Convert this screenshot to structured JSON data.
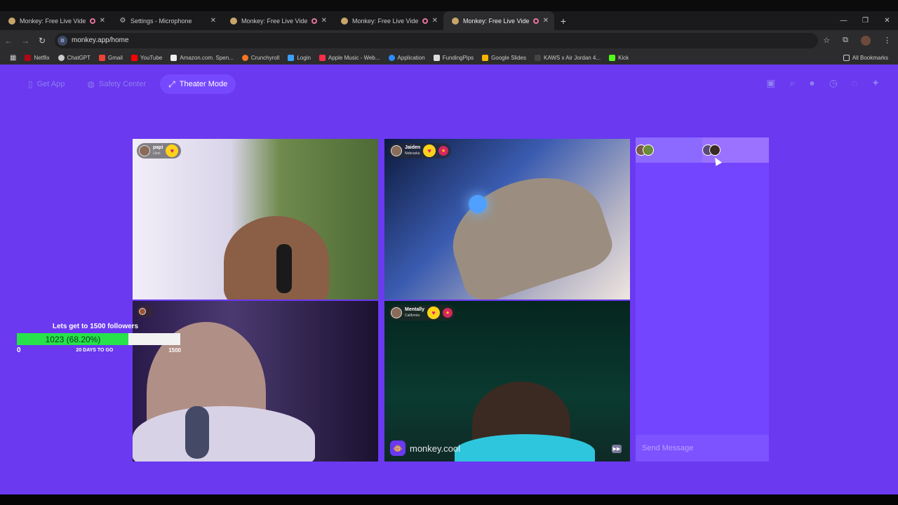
{
  "browser": {
    "tabs": [
      {
        "title": "Monkey: Free Live Video Ch",
        "active": false,
        "recording": true
      },
      {
        "title": "Settings - Microphone",
        "active": false,
        "recording": false
      },
      {
        "title": "Monkey: Free Live Video Ch",
        "active": false,
        "recording": true
      },
      {
        "title": "Monkey: Free Live Video Ch",
        "active": false,
        "recording": true
      },
      {
        "title": "Monkey: Free Live Video Ch",
        "active": true,
        "recording": true
      }
    ],
    "new_tab": "+",
    "close": "✕",
    "url": "monkey.app/home",
    "bookmarks": [
      {
        "label": "Netflix",
        "color": "#b20710"
      },
      {
        "label": "ChatGPT",
        "color": "#cccccc"
      },
      {
        "label": "Gmail",
        "color": "#ea4335"
      },
      {
        "label": "YouTube",
        "color": "#ff0000"
      },
      {
        "label": "Amazon.com. Spen...",
        "color": "#eeeeee"
      },
      {
        "label": "Crunchyroll",
        "color": "#f47521"
      },
      {
        "label": "Login",
        "color": "#3aa0ff"
      },
      {
        "label": "Apple Music - Web...",
        "color": "#fa2d48"
      },
      {
        "label": "Application",
        "color": "#2b8cff"
      },
      {
        "label": "FundingPips",
        "color": "#dddddd"
      },
      {
        "label": "Google Slides",
        "color": "#f4b400"
      },
      {
        "label": "KAWS x Air Jordan 4...",
        "color": "#222222"
      },
      {
        "label": "Kick",
        "color": "#53fc18"
      }
    ],
    "all_bookmarks": "All Bookmarks"
  },
  "app": {
    "buttons": {
      "get_app": "Get App",
      "safety_center": "Safety Center",
      "theater_mode": "Theater Mode"
    },
    "accent": "#6a39f0",
    "tiles": [
      {
        "name": "papi",
        "location": "Utah"
      },
      {
        "name": "Jaiden",
        "location": "Nebraska"
      },
      {
        "name": "",
        "location": ""
      },
      {
        "name": "Mentally",
        "location": "California"
      }
    ],
    "watermark": "monkey.cool",
    "chat": {
      "placeholder": "Send Message"
    }
  },
  "goal": {
    "title": "Lets get to 1500 followers",
    "current_label": "1023 (68.20%)",
    "progress": 0.682,
    "start": "0",
    "days_left": "20 DAYS TO GO",
    "end": "1500"
  }
}
